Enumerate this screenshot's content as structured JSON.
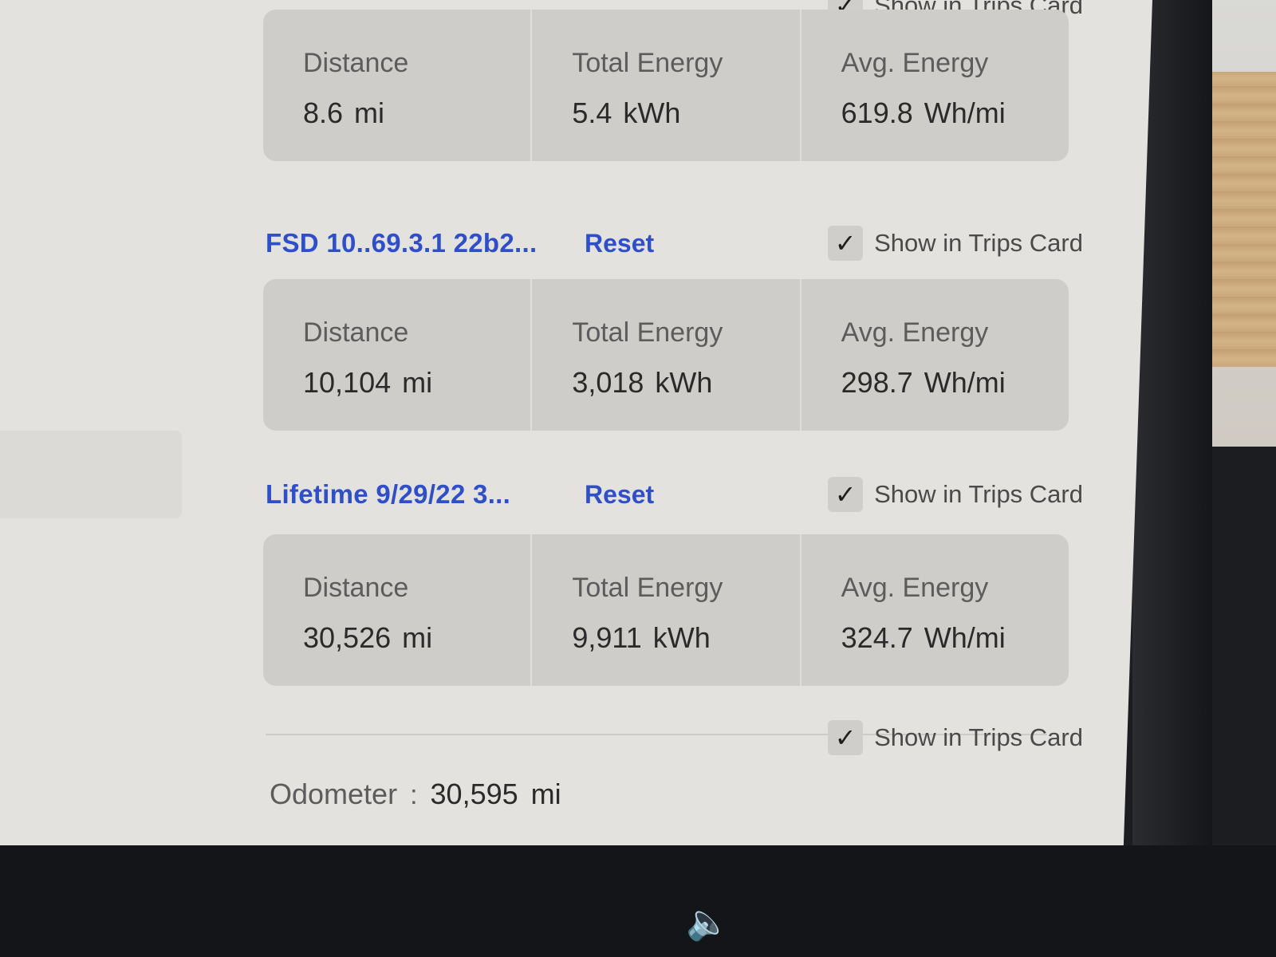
{
  "trips": [
    {
      "title": "",
      "reset_label": "",
      "show_label": "Show in Trips Card",
      "distance_label": "Distance",
      "distance_value": "8.6",
      "distance_unit": "mi",
      "energy_label": "Total Energy",
      "energy_value": "5.4",
      "energy_unit": "kWh",
      "avg_label": "Avg. Energy",
      "avg_value": "619.8",
      "avg_unit": "Wh/mi"
    },
    {
      "title": "FSD 10..69.3.1 22b2...",
      "reset_label": "Reset",
      "show_label": "Show in Trips Card",
      "distance_label": "Distance",
      "distance_value": "10,104",
      "distance_unit": "mi",
      "energy_label": "Total Energy",
      "energy_value": "3,018",
      "energy_unit": "kWh",
      "avg_label": "Avg. Energy",
      "avg_value": "298.7",
      "avg_unit": "Wh/mi"
    },
    {
      "title": "Lifetime 9/29/22 3...",
      "reset_label": "Reset",
      "show_label": "Show in Trips Card",
      "distance_label": "Distance",
      "distance_value": "30,526",
      "distance_unit": "mi",
      "energy_label": "Total Energy",
      "energy_value": "9,911",
      "energy_unit": "kWh",
      "avg_label": "Avg. Energy",
      "avg_value": "324.7",
      "avg_unit": "Wh/mi"
    }
  ],
  "odometer": {
    "label": "Odometer",
    "separator": ":",
    "value": "30,595",
    "unit": "mi",
    "show_label": "Show in Trips Card"
  },
  "icons": {
    "check": "✓",
    "volume": "🔈"
  },
  "colors": {
    "link": "#2f4fc9",
    "screen_bg": "#e4e2df",
    "card_bg": "#cfcdca"
  }
}
